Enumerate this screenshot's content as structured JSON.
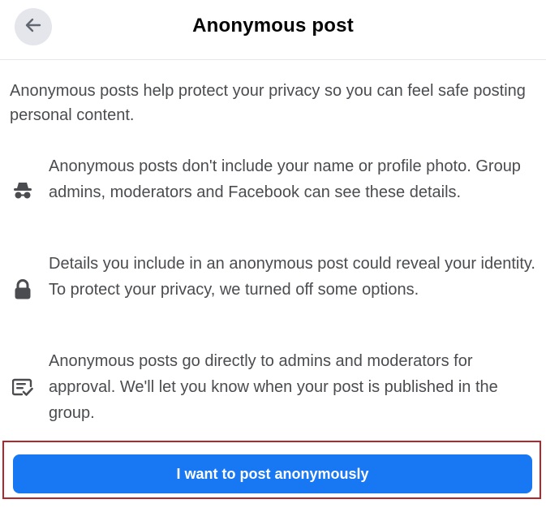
{
  "header": {
    "back_icon": "arrow-left-icon",
    "title": "Anonymous post"
  },
  "intro": "Anonymous posts help protect your privacy so you can feel safe posting personal content.",
  "items": [
    {
      "icon": "incognito-icon",
      "text": "Anonymous posts don't include your name or profile photo. Group admins, moderators and Facebook can see these details."
    },
    {
      "icon": "lock-icon",
      "text": "Details you include in an anonymous post could reveal your identity. To protect your privacy, we turned off some options."
    },
    {
      "icon": "approval-icon",
      "text": "Anonymous posts go directly to admins and moderators for approval. We'll let you know when your post is published in the group."
    }
  ],
  "cta": {
    "label": "I want to post anonymously"
  },
  "colors": {
    "primary": "#1877f2",
    "highlight_border": "#b3262c"
  }
}
